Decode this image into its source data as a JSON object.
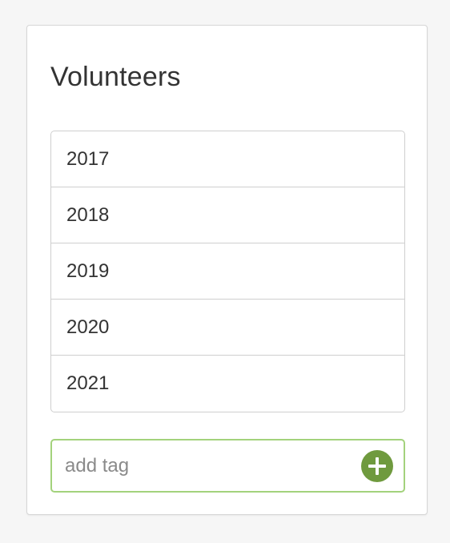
{
  "panel": {
    "title": "Volunteers"
  },
  "tags": [
    {
      "label": "2017"
    },
    {
      "label": "2018"
    },
    {
      "label": "2019"
    },
    {
      "label": "2020"
    },
    {
      "label": "2021"
    }
  ],
  "add_tag": {
    "value": "",
    "placeholder": "add tag",
    "button_icon": "plus-circle-icon"
  },
  "colors": {
    "accent": "#6f9a3e",
    "input_border": "#a3d27c"
  }
}
